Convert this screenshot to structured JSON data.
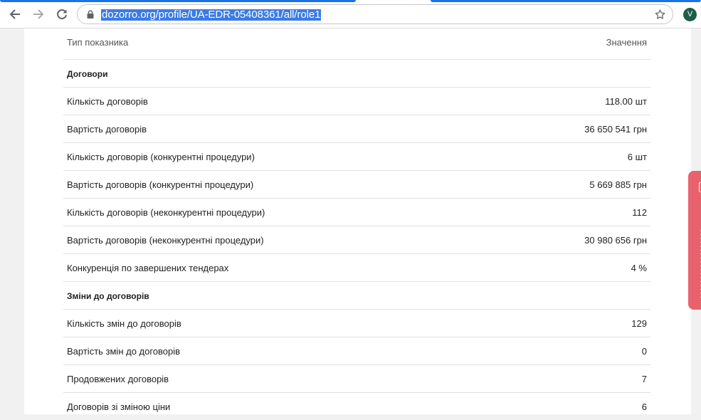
{
  "browser": {
    "url": "dozorro.org/profile/UA-EDR-05408361/all/role1",
    "avatar_letter": "V",
    "icons": {
      "back": "arrow-left-icon",
      "forward": "arrow-right-icon",
      "reload": "reload-icon",
      "lock": "lock-icon",
      "bookmark": "star-icon"
    }
  },
  "table": {
    "header": {
      "key": "Тип показника",
      "value": "Значення"
    },
    "rows": [
      {
        "key": "Договори",
        "value": "",
        "section": true
      },
      {
        "key": "Кількість договорів",
        "value": "118.00 шт"
      },
      {
        "key": "Вартість договорів",
        "value": "36 650 541 грн"
      },
      {
        "key": "Кількість договорів (конкурентні процедури)",
        "value": "6 шт"
      },
      {
        "key": "Вартість договорів (конкурентні процедури)",
        "value": "5 669 885 грн"
      },
      {
        "key": "Кількість договорів (неконкурентні процедури)",
        "value": "112"
      },
      {
        "key": "Вартість договорів (неконкурентні процедури)",
        "value": "30 980 656 грн"
      },
      {
        "key": "Конкуренція по завершених тендерах",
        "value": "4 %"
      },
      {
        "key": "Зміни до договорів",
        "value": "",
        "section": true
      },
      {
        "key": "Кількість змін до договорів",
        "value": "129"
      },
      {
        "key": "Вартість змін до договорів",
        "value": "0"
      },
      {
        "key": "Продовжених договорів",
        "value": "7"
      },
      {
        "key": "Договорів зі зміною ціни",
        "value": "6"
      }
    ]
  },
  "colors": {
    "feedback_tab": "#e8626d",
    "url_highlight": "#3b7be6",
    "tab_accent": "#1a73e8"
  }
}
